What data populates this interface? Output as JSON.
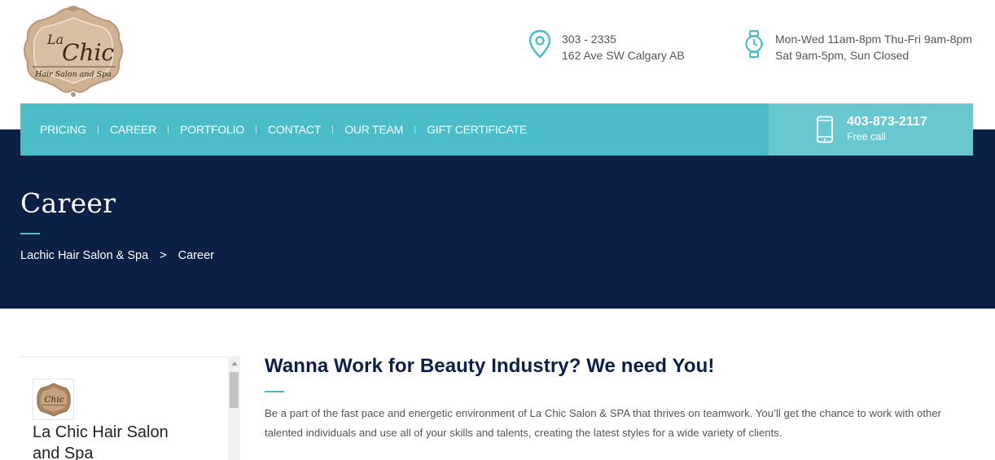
{
  "header": {
    "logo": {
      "alt": "La Chic Hair Salon and Spa",
      "line1": "La",
      "line2": "Chic",
      "tagline": "Hair Salon and Spa"
    },
    "address": {
      "icon": "map-pin-icon",
      "line1": "303 - 2335",
      "line2": "162 Ave SW Calgary AB"
    },
    "hours": {
      "icon": "watch-icon",
      "line1": "Mon-Wed 11am-8pm Thu-Fri 9am-8pm",
      "line2": "Sat 9am-5pm, Sun Closed"
    }
  },
  "nav": {
    "items": [
      {
        "label": "PRICING"
      },
      {
        "label": "CAREER"
      },
      {
        "label": "PORTFOLIO"
      },
      {
        "label": "CONTACT"
      },
      {
        "label": "OUR TEAM"
      },
      {
        "label": "GIFT CERTIFICATE"
      }
    ],
    "phone": {
      "icon": "smartphone-icon",
      "number": "403-873-2117",
      "subtitle": "Free call"
    }
  },
  "page": {
    "title": "Career",
    "breadcrumb": {
      "home": "Lachic Hair Salon & Spa",
      "separator": ">",
      "current": "Career"
    }
  },
  "sidebar": {
    "name": "La Chic Hair Salon and Spa"
  },
  "main": {
    "heading": "Wanna Work for Beauty Industry? We need You!",
    "paragraph": "Be a part of the fast pace and energetic environment of La Chic Salon & SPA that thrives on teamwork. You’ll get the chance to work with other talented individuals and use all of your skills and talents, creating the latest styles for a wide variety of clients."
  },
  "colors": {
    "accent": "#4bbdc8",
    "accent_light": "#68c7cf",
    "navy": "#0c1f45",
    "logo_tan": "#c9ac8e"
  }
}
